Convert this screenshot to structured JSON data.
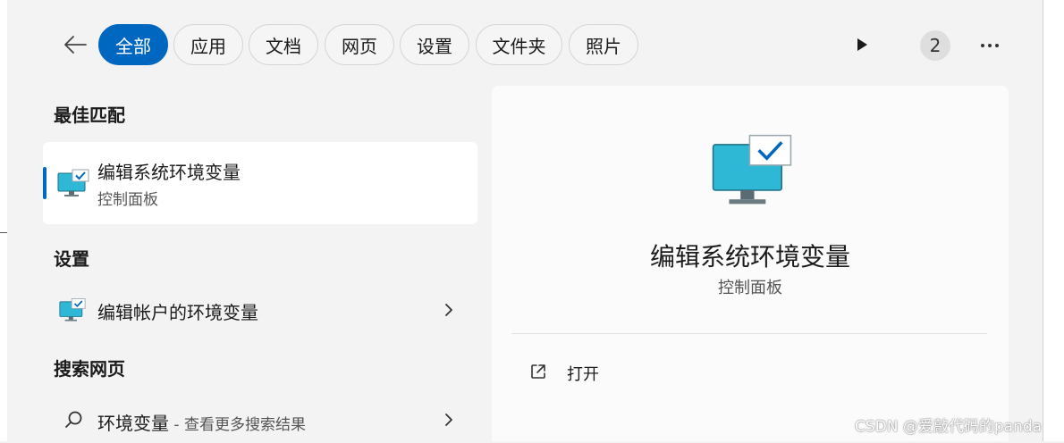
{
  "filters": [
    {
      "label": "全部",
      "active": true
    },
    {
      "label": "应用"
    },
    {
      "label": "文档"
    },
    {
      "label": "网页"
    },
    {
      "label": "设置"
    },
    {
      "label": "文件夹"
    },
    {
      "label": "照片"
    }
  ],
  "toolbar": {
    "count_badge": "2"
  },
  "sections": {
    "best_match": "最佳匹配",
    "settings": "设置",
    "web": "搜索网页"
  },
  "best_match": {
    "title": "编辑系统环境变量",
    "subtitle": "控制面板"
  },
  "settings_item": {
    "title": "编辑帐户的环境变量"
  },
  "web_item": {
    "query": "环境变量",
    "suffix": " - 查看更多搜索结果"
  },
  "detail": {
    "title": "编辑系统环境变量",
    "subtitle": "控制面板",
    "action_open": "打开"
  },
  "icons": {
    "back": "arrow-left-icon",
    "play": "play-icon",
    "more": "more-horizontal-icon",
    "app": "monitor-check-icon",
    "search": "search-icon",
    "chevron": "chevron-right-icon",
    "open": "external-link-icon"
  },
  "colors": {
    "accent": "#0067c0",
    "monitor": "#2fb8d6"
  },
  "watermark": "CSDN @爱敲代码的panda"
}
